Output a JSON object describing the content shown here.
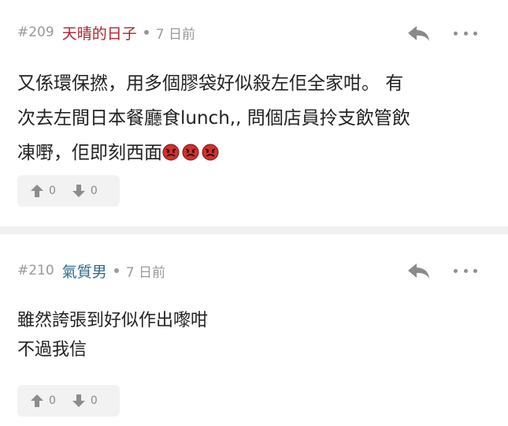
{
  "comments": [
    {
      "number": "#209",
      "username": "天晴的日子",
      "time": "7 日前",
      "text_line1": "又係環保撚，用多個膠袋好似殺左佢全家咁。 有",
      "text_line2": "次去左間日本餐廳食lunch,, 問個店員拎支飲管飲",
      "text_line3": "凍嘢，佢即刻西面",
      "emojis": [
        "angry-face-icon",
        "angry-face-icon",
        "angry-face-icon"
      ],
      "upvotes": "0",
      "downvotes": "0"
    },
    {
      "number": "#210",
      "username": "氣質男",
      "time": "7 日前",
      "text_line1": "雖然誇張到好似作出嚟咁",
      "text_line2": "不過我信",
      "upvotes": "0",
      "downvotes": "0"
    }
  ],
  "colors": {
    "username_1": "#b1232a",
    "username_2": "#2b6a8a",
    "meta_gray": "#999999",
    "divider": "#f0f0f0",
    "vote_bg": "#f2f2f2"
  }
}
